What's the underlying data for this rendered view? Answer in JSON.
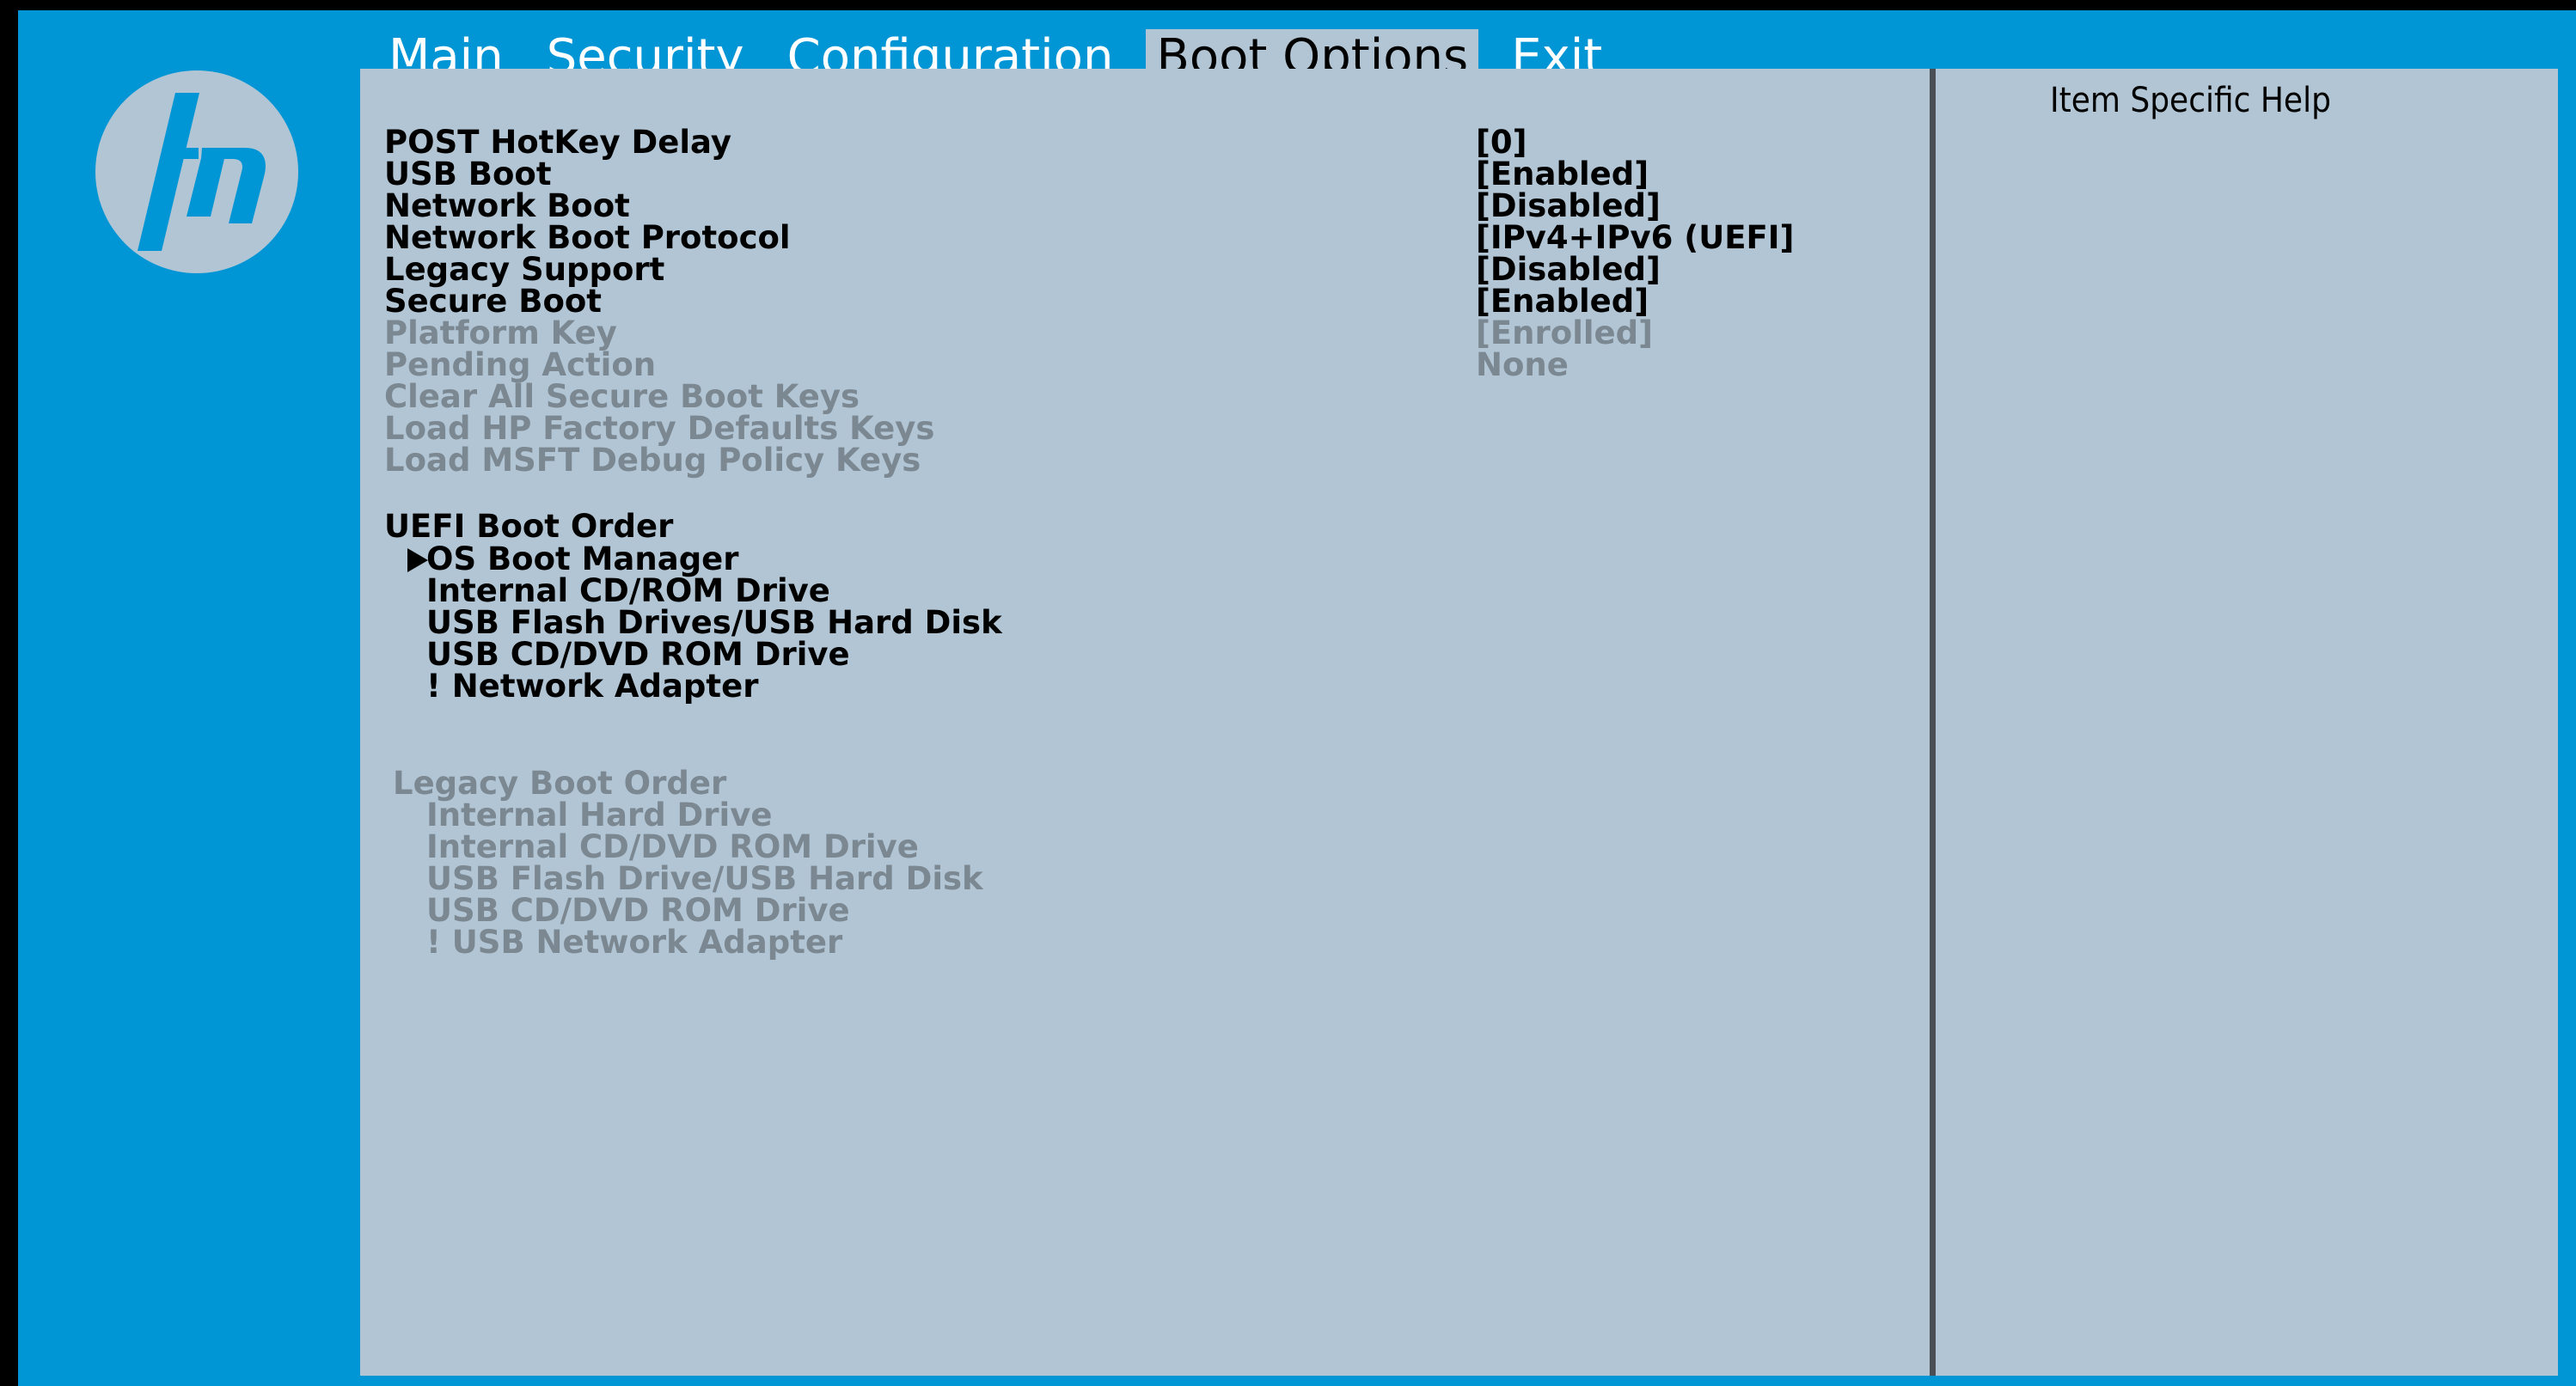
{
  "tabs": [
    {
      "label": "Main"
    },
    {
      "label": "Security"
    },
    {
      "label": "Configuration"
    },
    {
      "label": "Boot Options",
      "active": true
    },
    {
      "label": "Exit"
    }
  ],
  "help": {
    "title": "Item Specific Help"
  },
  "settings": [
    {
      "label": "POST HotKey Delay",
      "value": "[0]",
      "enabled": true
    },
    {
      "label": "USB Boot",
      "value": "[Enabled]",
      "enabled": true
    },
    {
      "label": "Network Boot",
      "value": "[Disabled]",
      "enabled": true
    },
    {
      "label": "Network Boot Protocol",
      "value": "[IPv4+IPv6 (UEFI]",
      "enabled": true
    },
    {
      "label": "Legacy Support",
      "value": "[Disabled]",
      "enabled": true
    },
    {
      "label": "Secure Boot",
      "value": "[Enabled]",
      "enabled": true
    },
    {
      "label": "Platform Key",
      "value": "[Enrolled]",
      "enabled": false
    },
    {
      "label": "Pending Action",
      "value": "None",
      "enabled": false
    },
    {
      "label": "Clear All Secure Boot Keys",
      "value": "",
      "enabled": false
    },
    {
      "label": "Load HP Factory Defaults Keys",
      "value": "",
      "enabled": false
    },
    {
      "label": "Load MSFT Debug Policy Keys",
      "value": "",
      "enabled": false
    }
  ],
  "uefi_boot_order": {
    "title": "UEFI Boot Order",
    "items": [
      "OS Boot Manager",
      "Internal CD/ROM Drive",
      "USB Flash Drives/USB Hard Disk",
      "USB CD/DVD ROM Drive",
      "! Network Adapter"
    ],
    "selected_index": 0
  },
  "legacy_boot_order": {
    "title": "Legacy Boot Order",
    "items": [
      "Internal Hard Drive",
      "Internal CD/DVD ROM Drive",
      "USB Flash Drive/USB Hard Disk",
      "USB CD/DVD ROM Drive",
      "! USB Network Adapter"
    ]
  },
  "colors": {
    "brand_blue": "#0096d6",
    "panel": "#b1c5d4",
    "disabled_text": "#7b8791"
  },
  "icons": {
    "logo": "hp-logo"
  }
}
